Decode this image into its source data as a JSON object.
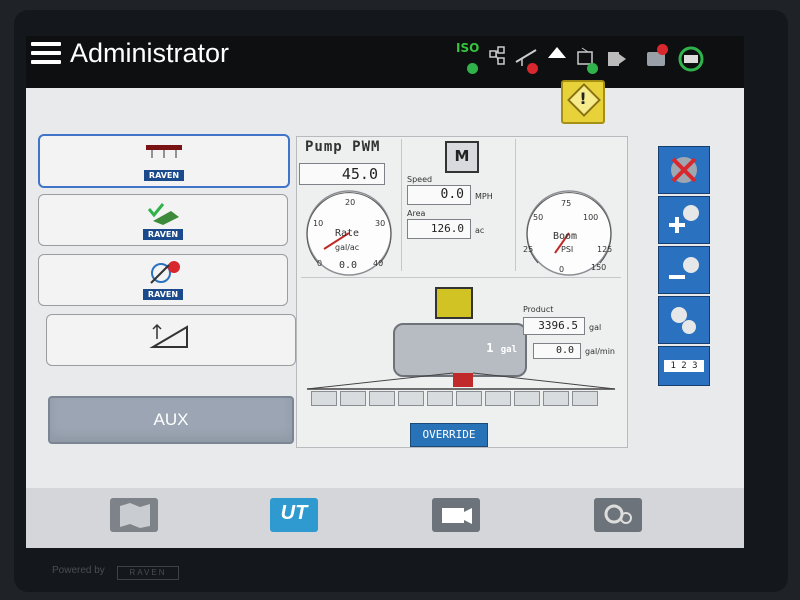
{
  "header": {
    "title": "Administrator",
    "status": {
      "iso_label": "ISO",
      "icons": [
        "iso-ok-icon",
        "network-icon",
        "sprayer-warning-icon",
        "up-arrow-icon",
        "gps-ok-icon",
        "ecu-icon",
        "controller-warning-icon",
        "rate-control-icon"
      ]
    },
    "alert_mark": "!"
  },
  "left_panel": {
    "buttons": [
      {
        "name": "boom-control",
        "badge": "RAVEN",
        "active": true
      },
      {
        "name": "field-map",
        "badge": "RAVEN",
        "active": false
      },
      {
        "name": "product-warning",
        "badge": "RAVEN",
        "active": false
      },
      {
        "name": "guidance",
        "badge": "",
        "active": false
      }
    ],
    "aux_label": "AUX"
  },
  "center_panel": {
    "title": "Pump PWM",
    "pwm_value": "45.0",
    "rate_gauge": {
      "label": "Rate",
      "unit": "gal/ac",
      "value": "0.0",
      "ticks": [
        "0",
        "10",
        "20",
        "30",
        "40"
      ],
      "level": 0
    },
    "speed": {
      "label": "Speed",
      "value": "0.0",
      "unit": "MPH"
    },
    "area": {
      "label": "Area",
      "value": "126.0",
      "unit": "ac"
    },
    "m_icon_label": "M",
    "boom_gauge": {
      "label": "Boom",
      "unit": "PSI",
      "value": "0",
      "ticks": [
        "0",
        "25",
        "50",
        "75",
        "100",
        "125",
        "150"
      ],
      "level": 0
    },
    "tank": {
      "value": "1",
      "unit": "gal"
    },
    "product": {
      "label": "Product",
      "volume": "3396.5",
      "volume_unit": "gal",
      "flow": "0.0",
      "flow_unit": "gal/min"
    },
    "override_label": "OVERRIDE",
    "sections_count": 10
  },
  "right_toolbar": {
    "numpad_label": "1 2 3"
  },
  "bottom_bar": {
    "buttons": [
      "map",
      "ut",
      "camera",
      "settings"
    ],
    "ut_label": "UT"
  },
  "bezel": {
    "powered_by": "Powered by",
    "brand": "RAVEN"
  }
}
